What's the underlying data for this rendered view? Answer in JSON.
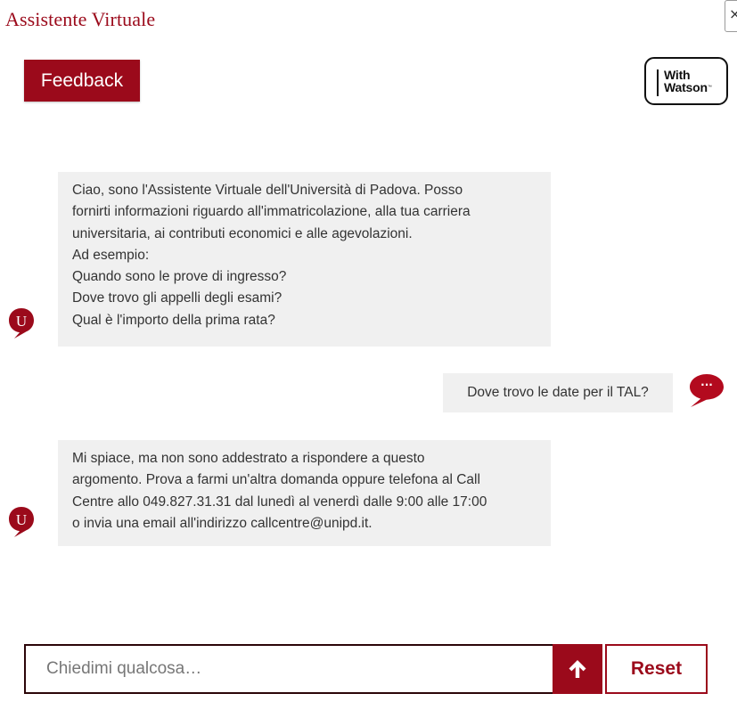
{
  "header": {
    "title": "Assistente Virtuale",
    "close_label": "×",
    "feedback_label": "Feedback",
    "watson_line1": "With",
    "watson_line2": "Watson",
    "watson_tm": "™"
  },
  "avatars": {
    "bot_letter": "U",
    "user_glyph": "···"
  },
  "messages": [
    {
      "from": "bot",
      "lines": [
        "Ciao, sono l'Assistente Virtuale dell'Università di Padova. Posso",
        "fornirti informazioni riguardo all'immatricolazione, alla tua carriera",
        "universitaria, ai contributi economici e alle agevolazioni.",
        "Ad esempio:",
        "Quando sono le prove di ingresso?",
        "Dove trovo gli appelli degli esami?",
        "Qual è l'importo della prima rata?"
      ]
    },
    {
      "from": "user",
      "text": "Dove trovo le date per il TAL?"
    },
    {
      "from": "bot",
      "lines": [
        "Mi spiace, ma non sono addestrato a rispondere a questo",
        "argomento. Prova a farmi un'altra domanda oppure telefona al Call",
        "Centre allo 049.827.31.31 dal lunedì al venerdì dalle 9:00 alle 17:00",
        "o invia una email all'indirizzo callcentre@unipd.it."
      ]
    }
  ],
  "composer": {
    "placeholder": "Chiedimi qualcosa…",
    "value": "",
    "send_icon": "arrow-up-icon",
    "reset_label": "Reset"
  },
  "colors": {
    "brand": "#9b0a1b",
    "bubble_bg": "#f0f0f0",
    "text": "#333333"
  }
}
